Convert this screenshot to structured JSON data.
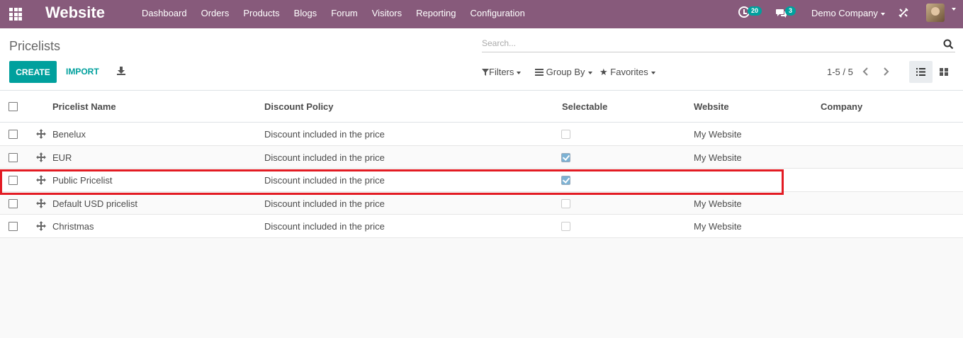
{
  "navbar": {
    "app_title": "Website",
    "menu": [
      "Dashboard",
      "Orders",
      "Products",
      "Blogs",
      "Forum",
      "Visitors",
      "Reporting",
      "Configuration"
    ],
    "activity_count": "20",
    "message_count": "3",
    "company": "Demo Company"
  },
  "control_panel": {
    "breadcrumb": "Pricelists",
    "search_placeholder": "Search...",
    "create_label": "CREATE",
    "import_label": "IMPORT",
    "filters_label": "Filters",
    "group_by_label": "Group By",
    "favorites_label": "Favorites",
    "pager": "1-5 / 5"
  },
  "table": {
    "columns": [
      "Pricelist Name",
      "Discount Policy",
      "Selectable",
      "Website",
      "Company"
    ],
    "rows": [
      {
        "name": "Benelux",
        "policy": "Discount included in the price",
        "selectable": false,
        "website": "My Website",
        "company": ""
      },
      {
        "name": "EUR",
        "policy": "Discount included in the price",
        "selectable": true,
        "website": "My Website",
        "company": ""
      },
      {
        "name": "Public Pricelist",
        "policy": "Discount included in the price",
        "selectable": true,
        "website": "",
        "company": ""
      },
      {
        "name": "Default USD pricelist",
        "policy": "Discount included in the price",
        "selectable": false,
        "website": "My Website",
        "company": ""
      },
      {
        "name": "Christmas",
        "policy": "Discount included in the price",
        "selectable": false,
        "website": "My Website",
        "company": ""
      }
    ]
  },
  "colors": {
    "navbar": "#875a7b",
    "accent": "#00a09d",
    "highlight": "#e31b23"
  },
  "icons": [
    "apps-icon",
    "activity-icon",
    "chat-icon",
    "debug-icon",
    "search-icon",
    "download-icon",
    "filter-icon",
    "group-by-icon",
    "star-icon",
    "chevron-left-icon",
    "chevron-right-icon",
    "list-view-icon",
    "kanban-view-icon",
    "drag-handle-icon"
  ]
}
